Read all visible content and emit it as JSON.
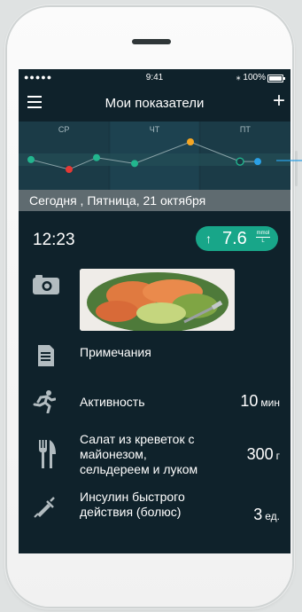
{
  "status_bar": {
    "signal": "●●●●● ",
    "time": "9:41",
    "battery": "⁎ 100%"
  },
  "header": {
    "title": "Мои показатели"
  },
  "chart_data": {
    "type": "line",
    "categories": [
      "СР",
      "ЧТ",
      "ПТ"
    ],
    "series": [
      {
        "values": [
          5.8,
          4.8,
          6.0,
          5.4,
          7.6,
          5.6,
          5.6
        ]
      }
    ],
    "point_colors": [
      "#22b58e",
      "#e53935",
      "#22b58e",
      "#22b58e",
      "#f5a623",
      "#22b58e",
      "#2aa0e6"
    ]
  },
  "date_bar": {
    "text": "Сегодня , Пятница, 21 октября"
  },
  "entry": {
    "time": "12:23",
    "glucose": {
      "value": "7.6",
      "unit_top": "mmol",
      "unit_bottom": "L"
    }
  },
  "rows": {
    "notes": {
      "label": "Примечания"
    },
    "activity": {
      "label": "Активность",
      "value": "10",
      "unit": "мин"
    },
    "food": {
      "label_line1": "Салат из креветок с",
      "label_line2": "майонезом,",
      "label_line3": "сельдереем и луком",
      "value": "300",
      "unit": "г"
    },
    "insulin": {
      "label_line1": "Инсулин быстрого",
      "label_line2": "действия (болюс)",
      "value": "3",
      "unit": "ед."
    }
  },
  "colors": {
    "accent": "#18a689",
    "background": "#0f222b",
    "chart_bg": "#193743"
  }
}
